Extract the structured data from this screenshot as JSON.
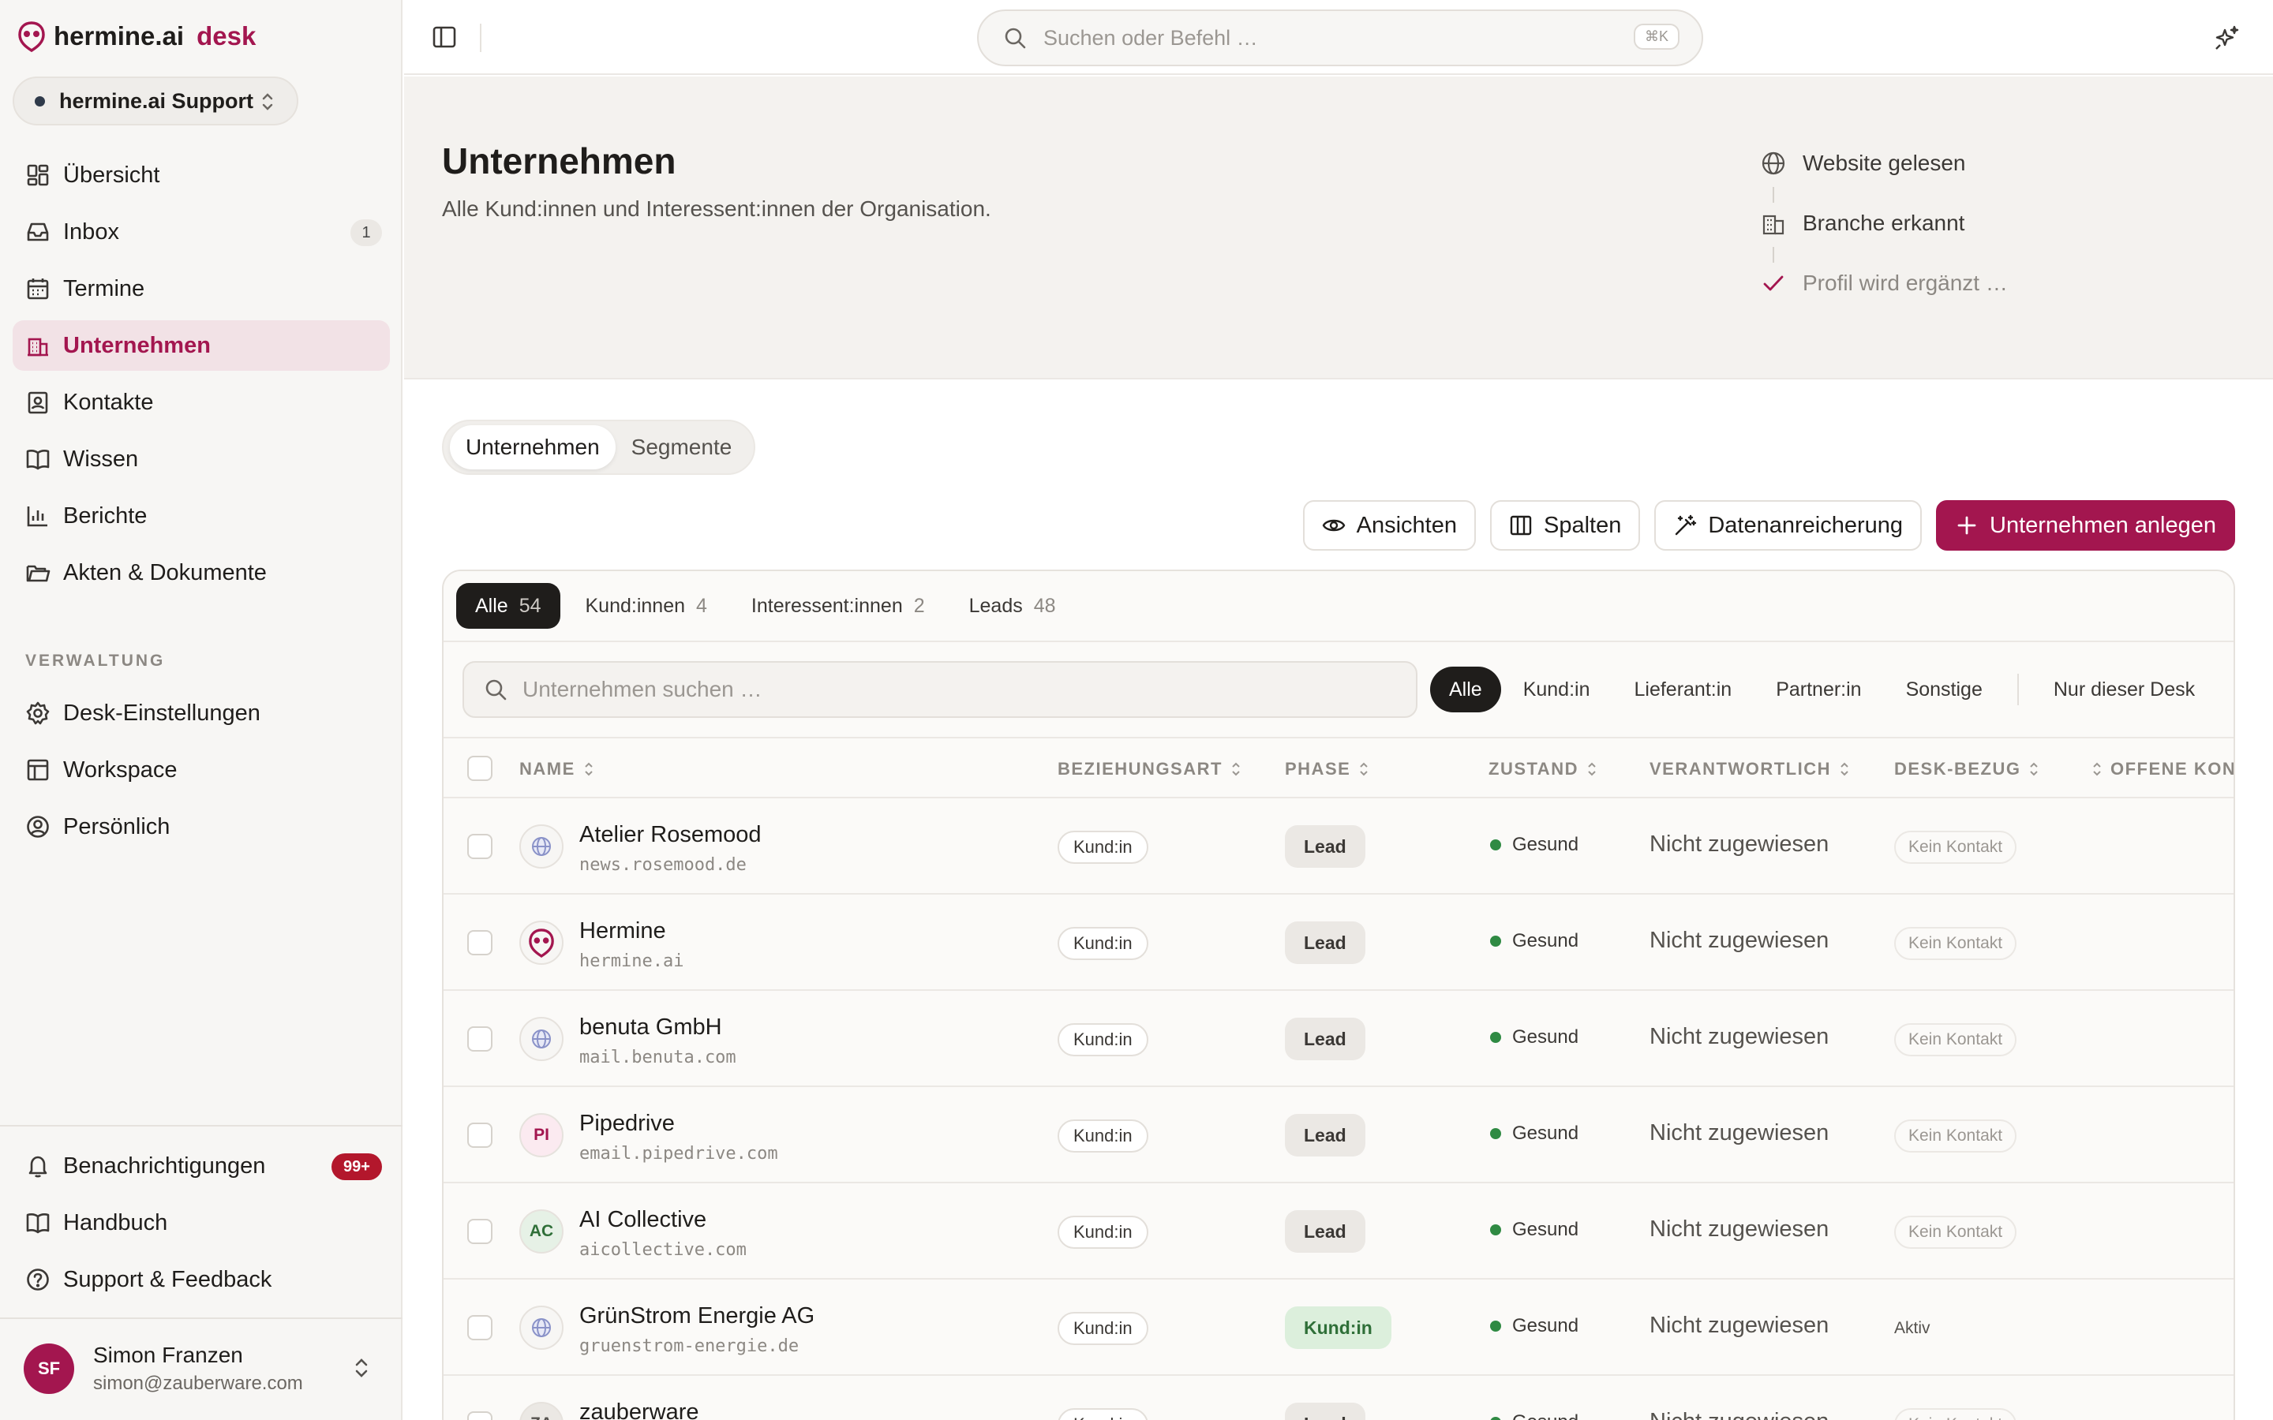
{
  "brand": {
    "name": "hermine.ai",
    "product": "desk",
    "accent": "#a3164f"
  },
  "workspace": {
    "label": "hermine.ai Support"
  },
  "nav": {
    "items": [
      {
        "label": "Übersicht",
        "icon": "dashboard-icon"
      },
      {
        "label": "Inbox",
        "icon": "inbox-icon",
        "badge": "1"
      },
      {
        "label": "Termine",
        "icon": "calendar-icon"
      },
      {
        "label": "Unternehmen",
        "icon": "building-icon",
        "active": true
      },
      {
        "label": "Kontakte",
        "icon": "contact-icon"
      },
      {
        "label": "Wissen",
        "icon": "book-icon"
      },
      {
        "label": "Berichte",
        "icon": "chart-icon"
      },
      {
        "label": "Akten & Dokumente",
        "icon": "folder-icon"
      }
    ],
    "section_label": "VERWALTUNG",
    "admin_items": [
      {
        "label": "Desk-Einstellungen",
        "icon": "gear-icon"
      },
      {
        "label": "Workspace",
        "icon": "layout-icon"
      },
      {
        "label": "Persönlich",
        "icon": "user-circle-icon"
      }
    ],
    "bottom_items": [
      {
        "label": "Benachrichtigungen",
        "icon": "bell-icon",
        "badge": "99+"
      },
      {
        "label": "Handbuch",
        "icon": "book-icon"
      },
      {
        "label": "Support & Feedback",
        "icon": "help-icon"
      }
    ]
  },
  "user": {
    "initials": "SF",
    "name": "Simon Franzen",
    "email": "simon@zauberware.com"
  },
  "topbar": {
    "search_placeholder": "Suchen oder Befehl …",
    "shortcut": "⌘K"
  },
  "header": {
    "title": "Unternehmen",
    "subtitle": "Alle Kund:innen und Interessent:innen der Organisation.",
    "steps": [
      "Website gelesen",
      "Branche erkannt",
      "Profil wird ergänzt …"
    ]
  },
  "tabs": [
    "Unternehmen",
    "Segmente"
  ],
  "actions": {
    "views": "Ansichten",
    "columns": "Spalten",
    "enrich": "Datenanreicherung",
    "create": "Unternehmen anlegen"
  },
  "filters": [
    {
      "label": "Alle",
      "count": "54"
    },
    {
      "label": "Kund:innen",
      "count": "4"
    },
    {
      "label": "Interessent:innen",
      "count": "2"
    },
    {
      "label": "Leads",
      "count": "48"
    }
  ],
  "table_search_placeholder": "Unternehmen suchen …",
  "relation_filters": [
    "Alle",
    "Kund:in",
    "Lieferant:in",
    "Partner:in",
    "Sonstige",
    "Nur dieser Desk"
  ],
  "columns": [
    "NAME",
    "BEZIEHUNGSART",
    "PHASE",
    "ZUSTAND",
    "VERANTWORTLICH",
    "DESK-BEZUG",
    "OFFENE KONV"
  ],
  "rows": [
    {
      "name": "Atelier Rosemood",
      "domain": "news.rosemood.de",
      "logo": "globe",
      "relation": "Kund:in",
      "phase": "Lead",
      "health": "Gesund",
      "owner": "Nicht zugewiesen",
      "desk": "Kein Kontakt"
    },
    {
      "name": "Hermine",
      "domain": "hermine.ai",
      "logo": "hermine",
      "relation": "Kund:in",
      "phase": "Lead",
      "health": "Gesund",
      "owner": "Nicht zugewiesen",
      "desk": "Kein Kontakt"
    },
    {
      "name": "benuta GmbH",
      "domain": "mail.benuta.com",
      "logo": "globe",
      "relation": "Kund:in",
      "phase": "Lead",
      "health": "Gesund",
      "owner": "Nicht zugewiesen",
      "desk": "Kein Kontakt"
    },
    {
      "name": "Pipedrive",
      "domain": "email.pipedrive.com",
      "logo": "PI",
      "relation": "Kund:in",
      "phase": "Lead",
      "health": "Gesund",
      "owner": "Nicht zugewiesen",
      "desk": "Kein Kontakt"
    },
    {
      "name": "AI Collective",
      "domain": "aicollective.com",
      "logo": "AC",
      "relation": "Kund:in",
      "phase": "Lead",
      "health": "Gesund",
      "owner": "Nicht zugewiesen",
      "desk": "Kein Kontakt"
    },
    {
      "name": "GrünStrom Energie AG",
      "domain": "gruenstrom-energie.de",
      "logo": "globe",
      "relation": "Kund:in",
      "phase": "Kund:in",
      "health": "Gesund",
      "owner": "Nicht zugewiesen",
      "desk": "Aktiv"
    },
    {
      "name": "zauberware",
      "domain": "",
      "logo": "ZA",
      "relation": "Kund:in",
      "phase": "Lead",
      "health": "Gesund",
      "owner": "Nicht zugewiesen",
      "desk": "Kein Kontakt"
    }
  ]
}
